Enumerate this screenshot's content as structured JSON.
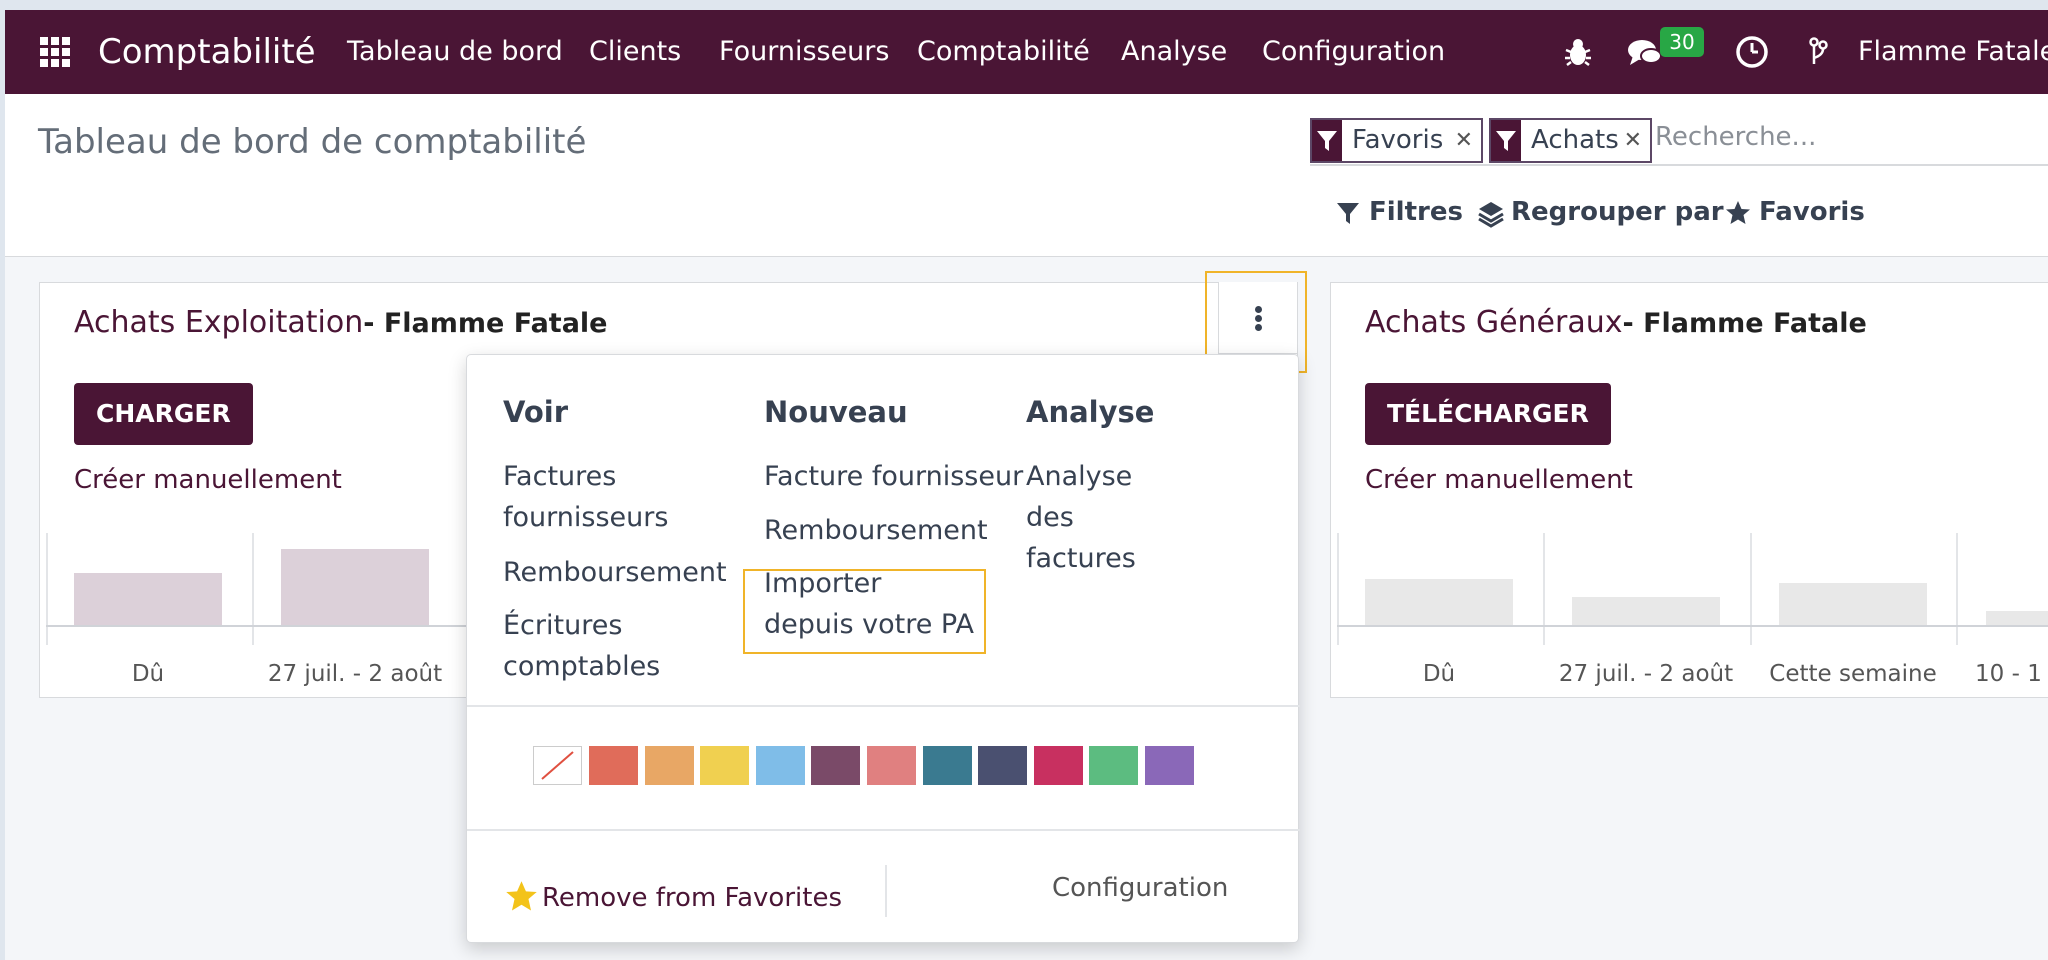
{
  "navbar": {
    "app_name": "Comptabilité",
    "menu": [
      "Tableau de bord",
      "Clients",
      "Fournisseurs",
      "Comptabilité",
      "Analyse",
      "Configuration"
    ],
    "messages_count": "30",
    "company": "Flamme Fatale",
    "icons": [
      "apps-grid-icon",
      "bug-icon",
      "chat-icon",
      "clock-icon",
      "branch-icon"
    ]
  },
  "control_panel": {
    "title": "Tableau de bord de comptabilité",
    "facets": [
      {
        "label": "Favoris",
        "icon": "filter-icon"
      },
      {
        "label": "Achats",
        "icon": "filter-icon"
      }
    ],
    "search_placeholder": "Recherche...",
    "buttons": {
      "filters": "Filtres",
      "group_by": "Regrouper par",
      "favorites": "Favoris"
    }
  },
  "cards": [
    {
      "title": "Achats Exploitation",
      "company": "- Flamme Fatale",
      "button": "CHARGER",
      "create_link": "Créer manuellement",
      "graph_labels": [
        "Dû",
        "27 juil. - 2 août"
      ]
    },
    {
      "title": "Achats Généraux",
      "company": "- Flamme Fatale",
      "button": "TÉLÉCHARGER",
      "create_link": "Créer manuellement",
      "graph_labels": [
        "Dû",
        "27 juil. - 2 août",
        "Cette semaine",
        "10 - 1"
      ]
    }
  ],
  "dropdown": {
    "columns": [
      {
        "heading": "Voir",
        "items": [
          "Factures fournisseurs",
          "Remboursement",
          "Écritures comptables"
        ]
      },
      {
        "heading": "Nouveau",
        "items": [
          "Facture fournisseur",
          "Remboursement",
          "Importer depuis votre PA"
        ]
      },
      {
        "heading": "Analyse",
        "items": [
          "Analyse des factures"
        ]
      }
    ],
    "colors": [
      "none",
      "#e06c5a",
      "#e8a765",
      "#f0d050",
      "#7fbde8",
      "#7a4a68",
      "#e08080",
      "#3a7a90",
      "#4a5070",
      "#c83060",
      "#5cbc80",
      "#8a68b8"
    ],
    "favorite_action": "Remove from Favorites",
    "configuration": "Configuration"
  }
}
